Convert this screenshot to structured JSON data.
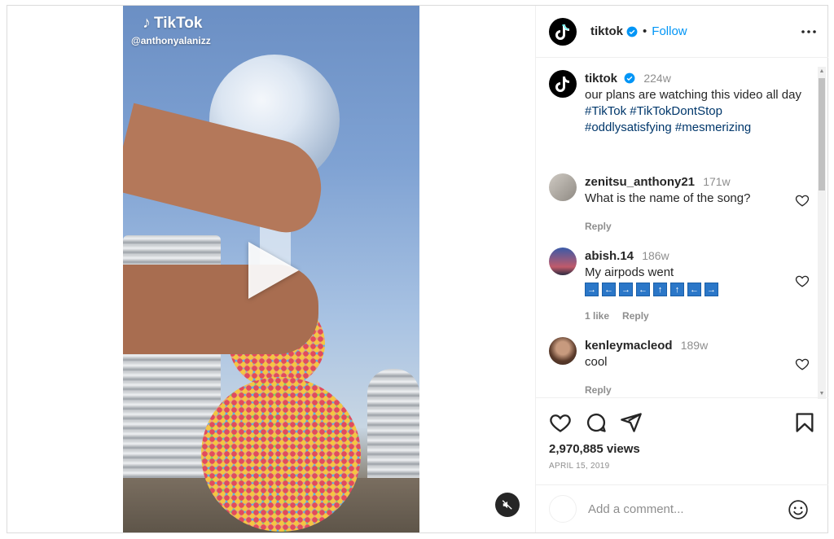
{
  "video": {
    "watermark_brand": "TikTok",
    "watermark_handle": "@anthonyalanizz"
  },
  "header": {
    "username": "tiktok",
    "separator": "•",
    "follow_label": "Follow"
  },
  "caption": {
    "username": "tiktok",
    "time": "224w",
    "text": "our plans are watching this video all day",
    "hashtags": [
      "#TikTok",
      "#TikTokDontStop",
      "#oddlysatisfying",
      "#mesmerizing"
    ]
  },
  "comments": [
    {
      "username": "zenitsu_anthony21",
      "time": "171w",
      "text": "What is the name of the song?",
      "likes": "",
      "reply_label": "Reply"
    },
    {
      "username": "abish.14",
      "time": "186w",
      "text": "My airpods went",
      "arrows": [
        "→",
        "←",
        "→",
        "←",
        "↑",
        "↑",
        "←",
        "→"
      ],
      "likes": "1 like",
      "reply_label": "Reply"
    },
    {
      "username": "kenleymacleod",
      "time": "189w",
      "text": "cool",
      "likes": "",
      "reply_label": "Reply"
    }
  ],
  "stats": {
    "views": "2,970,885 views",
    "date": "APRIL 15, 2019"
  },
  "add_comment": {
    "placeholder": "Add a comment..."
  },
  "colors": {
    "link_blue": "#0095f6",
    "hashtag": "#00376b",
    "muted": "#8e8e8e"
  }
}
